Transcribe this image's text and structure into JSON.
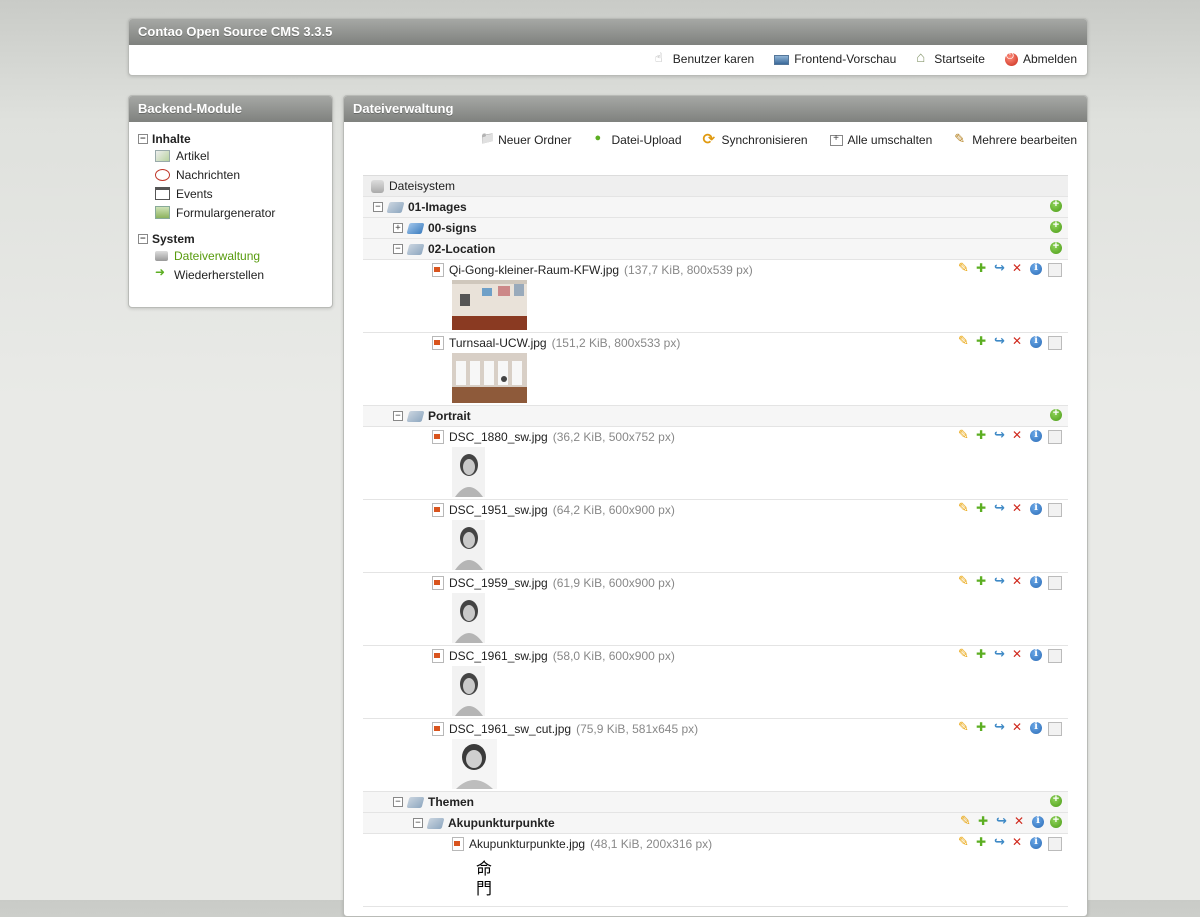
{
  "header": {
    "title": "Contao Open Source CMS 3.3.5",
    "links": [
      {
        "label": "Benutzer karen",
        "icon": "user-icon"
      },
      {
        "label": "Frontend-Vorschau",
        "icon": "monitor-icon"
      },
      {
        "label": "Startseite",
        "icon": "home-icon"
      },
      {
        "label": "Abmelden",
        "icon": "logout-icon"
      }
    ]
  },
  "nav": {
    "title": "Backend-Module",
    "groups": [
      {
        "label": "Inhalte",
        "toggle": "−",
        "items": [
          {
            "label": "Artikel",
            "icon": "article-icon"
          },
          {
            "label": "Nachrichten",
            "icon": "news-icon"
          },
          {
            "label": "Events",
            "icon": "calendar-icon"
          },
          {
            "label": "Formulargenerator",
            "icon": "form-icon"
          }
        ]
      },
      {
        "label": "System",
        "toggle": "−",
        "items": [
          {
            "label": "Dateiverwaltung",
            "icon": "filemanager-icon",
            "active": true
          },
          {
            "label": "Wiederherstellen",
            "icon": "restore-icon"
          }
        ]
      }
    ]
  },
  "main": {
    "title": "Dateiverwaltung",
    "toolbar": [
      {
        "label": "Neuer Ordner",
        "icon": "new-folder-icon"
      },
      {
        "label": "Datei-Upload",
        "icon": "upload-icon"
      },
      {
        "label": "Synchronisieren",
        "icon": "sync-icon"
      },
      {
        "label": "Alle umschalten",
        "icon": "toggle-all-icon"
      },
      {
        "label": "Mehrere bearbeiten",
        "icon": "edit-multiple-icon"
      }
    ],
    "root": "Dateisystem",
    "tree": [
      {
        "type": "folder",
        "level": 0,
        "name": "01-Images",
        "toggle": "−"
      },
      {
        "type": "folder",
        "level": 1,
        "name": "00-signs",
        "toggle": "+",
        "blue": true
      },
      {
        "type": "folder",
        "level": 1,
        "name": "02-Location",
        "toggle": "−"
      },
      {
        "type": "file",
        "level": 2,
        "name": "Qi-Gong-kleiner-Raum-KFW.jpg",
        "meta": "(137,7 KiB, 800x539 px)",
        "thumb": "room"
      },
      {
        "type": "file",
        "level": 2,
        "name": "Turnsaal-UCW.jpg",
        "meta": "(151,2 KiB, 800x533 px)",
        "thumb": "hall"
      },
      {
        "type": "folder",
        "level": 1,
        "name": "Portrait",
        "toggle": "−"
      },
      {
        "type": "file",
        "level": 2,
        "name": "DSC_1880_sw.jpg",
        "meta": "(36,2 KiB, 500x752 px)",
        "thumb": "portrait"
      },
      {
        "type": "file",
        "level": 2,
        "name": "DSC_1951_sw.jpg",
        "meta": "(64,2 KiB, 600x900 px)",
        "thumb": "portrait"
      },
      {
        "type": "file",
        "level": 2,
        "name": "DSC_1959_sw.jpg",
        "meta": "(61,9 KiB, 600x900 px)",
        "thumb": "portrait"
      },
      {
        "type": "file",
        "level": 2,
        "name": "DSC_1961_sw.jpg",
        "meta": "(58,0 KiB, 600x900 px)",
        "thumb": "portrait"
      },
      {
        "type": "file",
        "level": 2,
        "name": "DSC_1961_sw_cut.jpg",
        "meta": "(75,9 KiB, 581x645 px)",
        "thumb": "portrait-wide"
      },
      {
        "type": "folder",
        "level": 1,
        "name": "Themen",
        "toggle": "−"
      },
      {
        "type": "folder",
        "level": 2,
        "name": "Akupunkturpunkte",
        "toggle": "−",
        "actions": true
      },
      {
        "type": "file",
        "level": 3,
        "name": "Akupunkturpunkte.jpg",
        "meta": "(48,1 KiB, 200x316 px)",
        "thumb": "glyph"
      }
    ]
  },
  "colors": {
    "title_bar": "#8a8c89",
    "active_link": "#589b0e",
    "add": "#5cae22",
    "delete": "#d02a1e",
    "info": "#2b6bb5"
  }
}
